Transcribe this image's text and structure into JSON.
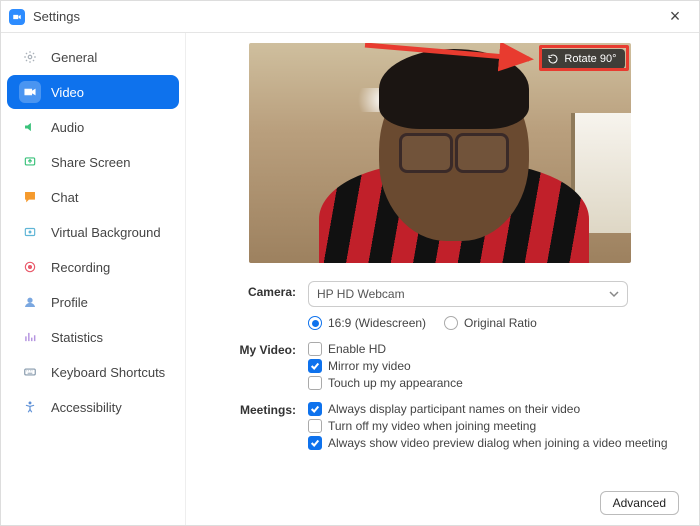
{
  "titlebar": {
    "title": "Settings"
  },
  "sidebar": {
    "items": [
      {
        "label": "General",
        "icon": "gear",
        "color": "#a9b0b8",
        "active": false
      },
      {
        "label": "Video",
        "icon": "video",
        "color": "#ffffff",
        "active": true
      },
      {
        "label": "Audio",
        "icon": "audio",
        "color": "#3ac27b",
        "active": false
      },
      {
        "label": "Share Screen",
        "icon": "share",
        "color": "#3ac27b",
        "active": false
      },
      {
        "label": "Chat",
        "icon": "chat",
        "color": "#f59a2d",
        "active": false
      },
      {
        "label": "Virtual Background",
        "icon": "virtual",
        "color": "#5fb5d6",
        "active": false
      },
      {
        "label": "Recording",
        "icon": "record",
        "color": "#e95b6c",
        "active": false
      },
      {
        "label": "Profile",
        "icon": "profile",
        "color": "#7aa7e0",
        "active": false
      },
      {
        "label": "Statistics",
        "icon": "stats",
        "color": "#b594e0",
        "active": false
      },
      {
        "label": "Keyboard Shortcuts",
        "icon": "keyboard",
        "color": "#8598ab",
        "active": false
      },
      {
        "label": "Accessibility",
        "icon": "accessibility",
        "color": "#5c8fd6",
        "active": false
      }
    ]
  },
  "rotate_button": {
    "label": "Rotate 90°"
  },
  "camera": {
    "label": "Camera:",
    "selected": "HP HD Webcam",
    "ratio_options": [
      {
        "label": "16:9 (Widescreen)",
        "checked": true
      },
      {
        "label": "Original Ratio",
        "checked": false
      }
    ]
  },
  "my_video": {
    "label": "My Video:",
    "options": [
      {
        "label": "Enable HD",
        "checked": false
      },
      {
        "label": "Mirror my video",
        "checked": true
      },
      {
        "label": "Touch up my appearance",
        "checked": false
      }
    ]
  },
  "meetings": {
    "label": "Meetings:",
    "options": [
      {
        "label": "Always display participant names on their video",
        "checked": true
      },
      {
        "label": "Turn off my video when joining meeting",
        "checked": false
      },
      {
        "label": "Always show video preview dialog when joining a video meeting",
        "checked": true
      }
    ]
  },
  "advanced_button": {
    "label": "Advanced"
  }
}
